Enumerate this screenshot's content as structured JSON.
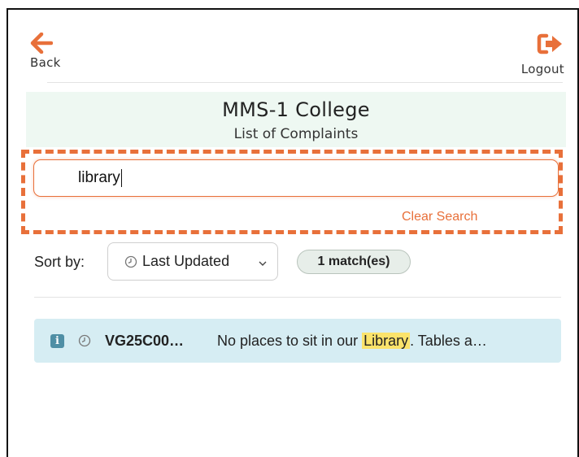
{
  "nav": {
    "back_label": "Back",
    "logout_label": "Logout"
  },
  "header": {
    "college_name": "MMS-1 College",
    "page_title": "List of Complaints"
  },
  "search": {
    "value": "library",
    "clear_label": "Clear Search"
  },
  "sort": {
    "label": "Sort by:",
    "selected": "Last Updated",
    "match_count": "1 match(es)"
  },
  "complaints": [
    {
      "id": "VG25C00…",
      "text_before": "No places to sit in our ",
      "highlight": "Library",
      "text_after": ". Tables a…"
    }
  ],
  "colors": {
    "accent": "#e8703a",
    "header_bg": "#eef8f2",
    "row_bg": "#d6edf3",
    "highlight": "#fbe36b"
  }
}
